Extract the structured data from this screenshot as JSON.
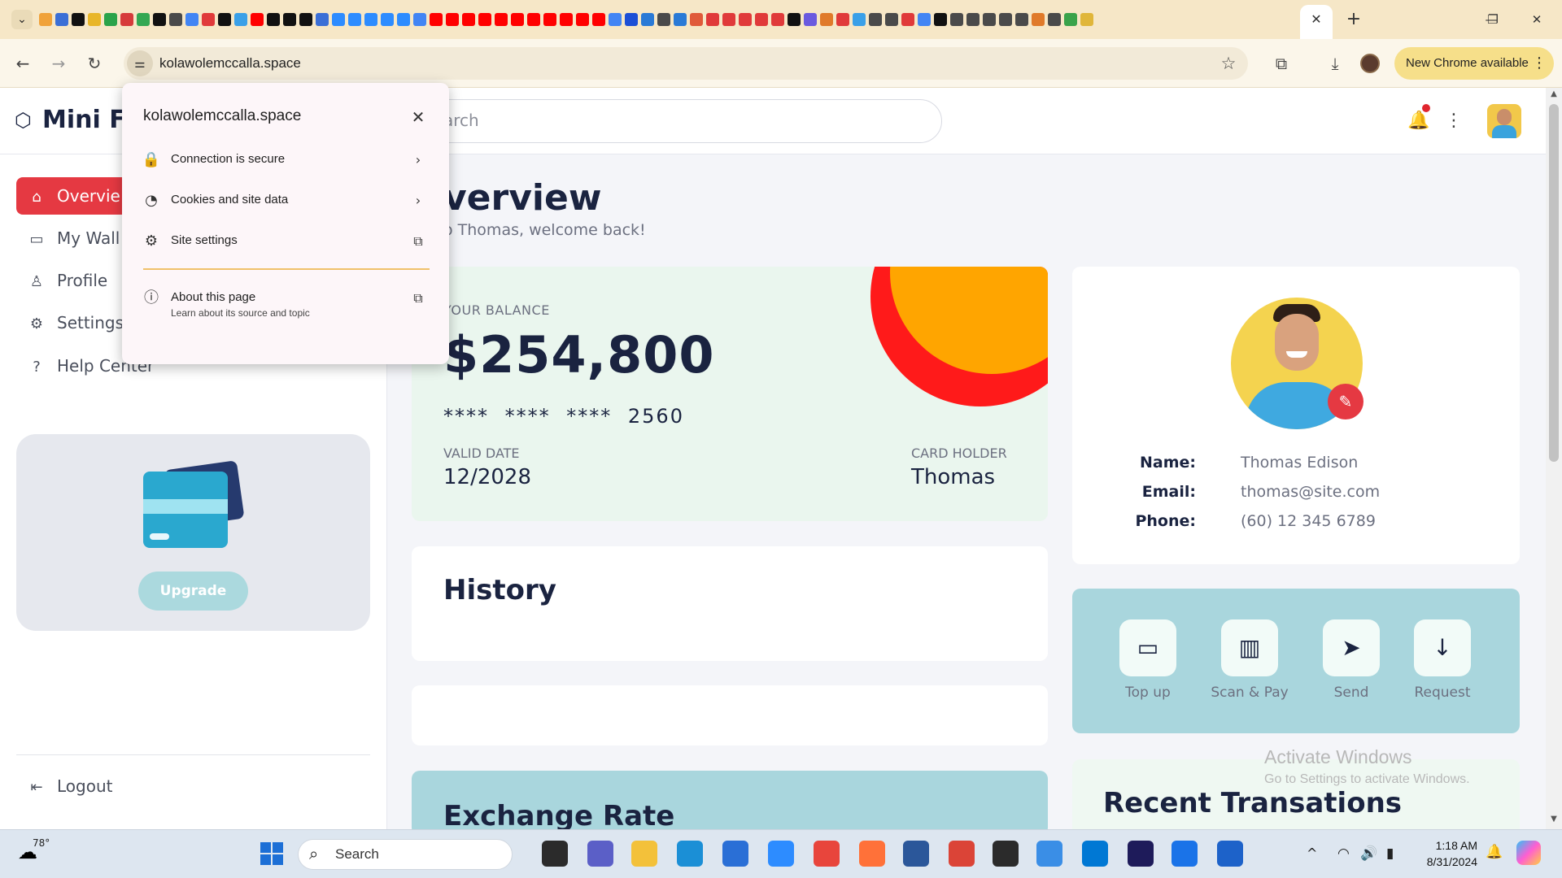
{
  "browser": {
    "tab_menu_icon": "chevron-down-icon",
    "tab_close": "✕",
    "new_tab": "+",
    "favicon_colors": [
      "#f0a23a",
      "#3b6fd6",
      "#111111",
      "#e8b629",
      "#2aa34a",
      "#d63b3b",
      "#34a853",
      "#111111",
      "#4a4a4a",
      "#4285f4",
      "#e03a3a",
      "#111111",
      "#3aa0e8",
      "#ff0000",
      "#111111",
      "#111111",
      "#111111",
      "#3b6fd6",
      "#2d8cff",
      "#2d8cff",
      "#2d8cff",
      "#2d8cff",
      "#2d8cff",
      "#4285f4",
      "#ff0000",
      "#ff0000",
      "#ff0000",
      "#ff0000",
      "#ff0000",
      "#ff0000",
      "#ff0000",
      "#ff0000",
      "#ff0000",
      "#ff0000",
      "#ff0000",
      "#4285f4",
      "#1c4fd6",
      "#2a7ad6",
      "#4a4a4a",
      "#2a7ad6",
      "#e05a3a",
      "#e03a3a",
      "#e03a3a",
      "#e03a3a",
      "#e03a3a",
      "#e03a3a",
      "#111111",
      "#6a5adf",
      "#e07a2a",
      "#e03a3a",
      "#3aa0e8",
      "#4a4a4a",
      "#4a4a4a",
      "#e03a3a",
      "#4285f4",
      "#111111",
      "#4a4a4a",
      "#4a4a4a",
      "#4a4a4a",
      "#4a4a4a",
      "#4a4a4a",
      "#e07a2a",
      "#4a4a4a",
      "#3aa34a",
      "#e0b63a"
    ],
    "window_controls": {
      "minimize": "—",
      "restore": "❐",
      "close": "✕"
    },
    "back": "←",
    "forward": "→",
    "reload": "↻",
    "site_info_icon": "tune-icon",
    "url": "kolawolemccalla.space",
    "bookmark": "☆",
    "extensions": "⧉",
    "download": "⤓",
    "new_chrome": "New Chrome available",
    "menu_dots": "⋮"
  },
  "popup": {
    "host": "kolawolemccalla.space",
    "close": "✕",
    "items": [
      {
        "icon": "lock-icon",
        "glyph": "🔒",
        "label": "Connection is secure",
        "arrow": "›"
      },
      {
        "icon": "cookie-icon",
        "glyph": "◔",
        "label": "Cookies and site data",
        "arrow": "›"
      },
      {
        "icon": "settings-icon",
        "glyph": "⚙",
        "label": "Site settings",
        "arrow": "⧉"
      }
    ],
    "about": {
      "icon": "info-icon",
      "glyph": "ⓘ",
      "label": "About this page",
      "sub": "Learn about its source and topic",
      "arrow": "⧉"
    }
  },
  "app": {
    "logo_text": "Mini Fi",
    "search_placeholder": "arch",
    "bell": "🔔",
    "kebab": "⋮"
  },
  "sidebar": {
    "items": [
      {
        "icon": "home-icon",
        "glyph": "⌂",
        "label": "Overvie"
      },
      {
        "icon": "wallet-icon",
        "glyph": "▭",
        "label": "My Wall"
      },
      {
        "icon": "user-icon",
        "glyph": "♙",
        "label": "Profile"
      },
      {
        "icon": "gear-icon",
        "glyph": "⚙",
        "label": "Settings"
      },
      {
        "icon": "help-icon",
        "glyph": "?",
        "label": "Help Center"
      }
    ],
    "upgrade_label": "Upgrade",
    "logout_glyph": "⇤",
    "logout_label": "Logout"
  },
  "main": {
    "title": "verview",
    "welcome": "o Thomas, welcome back!",
    "balance": {
      "label": "YOUR BALANCE",
      "amount": "$254,800",
      "card_number": "**** **** **** 2560",
      "valid_label": "VALID DATE",
      "valid_value": "12/2028",
      "holder_label": "CARD HOLDER",
      "holder_value": "Thomas"
    },
    "history_title": "History",
    "exchange_title": "Exchange Rate"
  },
  "profile": {
    "edit_glyph": "✎",
    "fields": [
      {
        "label": "Name:",
        "value": "Thomas Edison"
      },
      {
        "label": "Email:",
        "value": "thomas@site.com"
      },
      {
        "label": "Phone:",
        "value": "(60) 12 345 6789"
      }
    ]
  },
  "actions": [
    {
      "icon": "wallet-icon",
      "glyph": "▭",
      "label": "Top up"
    },
    {
      "icon": "barcode-icon",
      "glyph": "▥",
      "label": "Scan & Pay"
    },
    {
      "icon": "send-icon",
      "glyph": "➤",
      "label": "Send"
    },
    {
      "icon": "arrow-down-icon",
      "glyph": "↓",
      "label": "Request"
    }
  ],
  "recent_title": "Recent Transations",
  "watermark": {
    "title": "Activate Windows",
    "sub": "Go to Settings to activate Windows."
  },
  "taskbar": {
    "weather_temp": "78°",
    "weather_glyph": "☁",
    "search_label": "Search",
    "search_glyph": "⌕",
    "apps": [
      {
        "name": "file-manager-icon",
        "color": "#2b2b2b"
      },
      {
        "name": "teams-icon",
        "color": "#5b5fc7"
      },
      {
        "name": "file-explorer-icon",
        "color": "#f3c13a"
      },
      {
        "name": "edge-icon",
        "color": "#1b8fd6"
      },
      {
        "name": "store-icon",
        "color": "#2a6fd6"
      },
      {
        "name": "zoom-icon",
        "color": "#2d8cff"
      },
      {
        "name": "chrome-icon",
        "color": "#e8453c"
      },
      {
        "name": "firefox-icon",
        "color": "#ff7139"
      },
      {
        "name": "word-icon",
        "color": "#2b579a"
      },
      {
        "name": "chrome-profile-icon",
        "color": "#db4437"
      },
      {
        "name": "terminal-icon",
        "color": "#2b2b2b"
      },
      {
        "name": "notepad-icon",
        "color": "#3a8ee6"
      },
      {
        "name": "vscode-icon",
        "color": "#0078d4"
      },
      {
        "name": "media-encoder-icon",
        "color": "#1e1b5a"
      },
      {
        "name": "chrome-beta-icon",
        "color": "#1a73e8"
      },
      {
        "name": "defender-icon",
        "color": "#1d62c9"
      }
    ],
    "tray_chevron": "^",
    "wifi": "◠",
    "volume": "🔊",
    "battery": "▮",
    "time": "1:18 AM",
    "date": "8/31/2024"
  }
}
